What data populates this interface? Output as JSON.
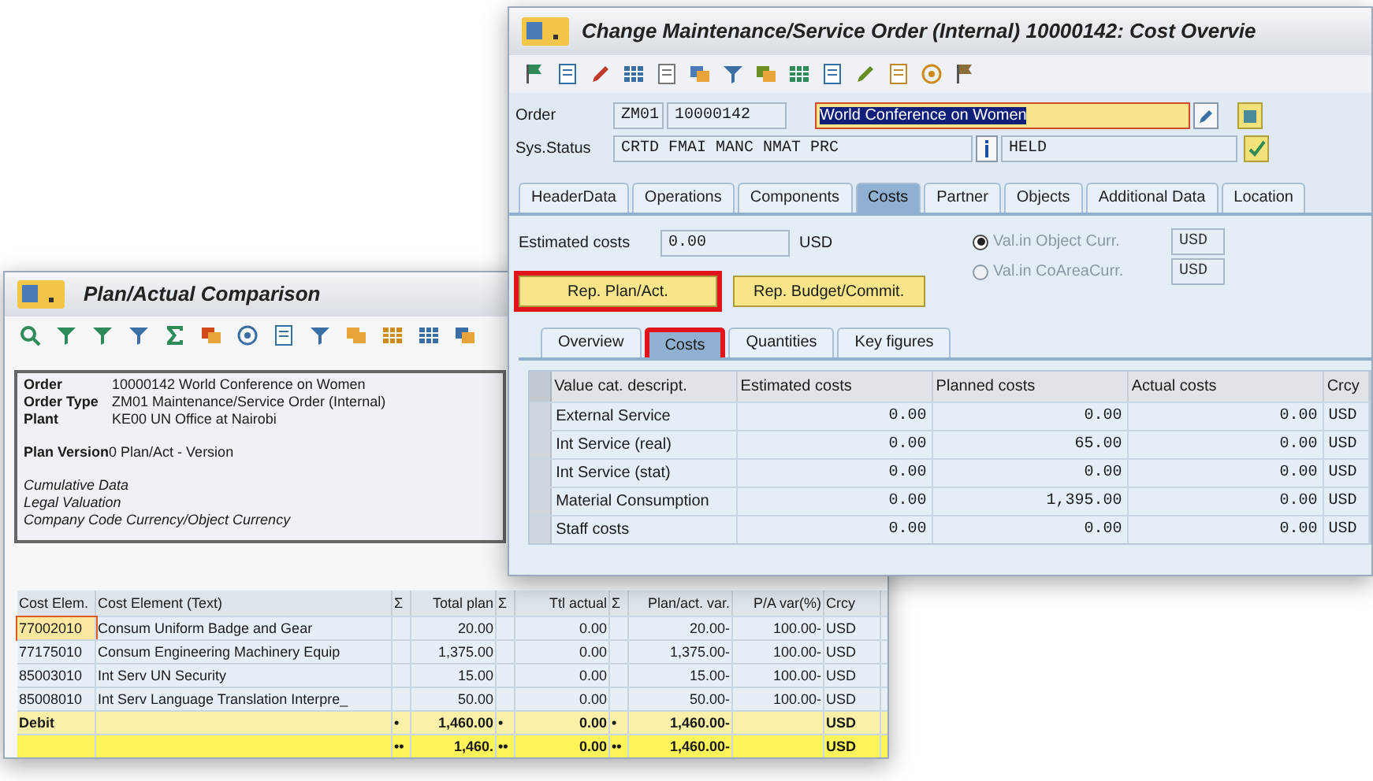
{
  "order_window": {
    "title": "Change Maintenance/Service Order (Internal) 10000142: Cost Overvie",
    "order": {
      "label": "Order",
      "type": "ZM01",
      "number": "10000142",
      "description": "World Conference on Women"
    },
    "status": {
      "label": "Sys.Status",
      "system_status": "CRTD FMAI MANC NMAT PRC",
      "user_status": "HELD"
    },
    "tabs": [
      {
        "label": "HeaderData",
        "selected": false
      },
      {
        "label": "Operations",
        "selected": false
      },
      {
        "label": "Components",
        "selected": false
      },
      {
        "label": "Costs",
        "selected": true
      },
      {
        "label": "Partner",
        "selected": false
      },
      {
        "label": "Objects",
        "selected": false
      },
      {
        "label": "Additional Data",
        "selected": false
      },
      {
        "label": "Location",
        "selected": false
      }
    ],
    "estimated_costs": {
      "label": "Estimated costs",
      "value": "0.00",
      "currency": "USD"
    },
    "currency_options": [
      {
        "label": "Val.in Object Curr.",
        "selected": true,
        "currency": "USD"
      },
      {
        "label": "Val.in CoAreaCurr.",
        "selected": false,
        "currency": "USD"
      }
    ],
    "buttons": [
      {
        "label": "Rep. Plan/Act.",
        "highlighted": true
      },
      {
        "label": "Rep. Budget/Commit.",
        "highlighted": false
      }
    ],
    "subtabs": [
      {
        "label": "Overview",
        "selected": false,
        "highlighted": false
      },
      {
        "label": "Costs",
        "selected": true,
        "highlighted": true
      },
      {
        "label": "Quantities",
        "selected": false,
        "highlighted": false
      },
      {
        "label": "Key figures",
        "selected": false,
        "highlighted": false
      }
    ],
    "table": {
      "columns": [
        "Value cat. descript.",
        "Estimated costs",
        "Planned costs",
        "Actual costs",
        "Crcy"
      ],
      "rows": [
        [
          "External Service",
          "0.00",
          "0.00",
          "0.00",
          "USD"
        ],
        [
          "Int Service (real)",
          "0.00",
          "65.00",
          "0.00",
          "USD"
        ],
        [
          "Int Service (stat)",
          "0.00",
          "0.00",
          "0.00",
          "USD"
        ],
        [
          "Material Consumption",
          "0.00",
          "1,395.00",
          "0.00",
          "USD"
        ],
        [
          "Staff costs",
          "0.00",
          "0.00",
          "0.00",
          "USD"
        ]
      ]
    }
  },
  "comparison_window": {
    "title": "Plan/Actual Comparison",
    "header": [
      {
        "label": "Order",
        "value": "10000142 World Conference on Women"
      },
      {
        "label": "Order Type",
        "value": "ZM01 Maintenance/Service Order (Internal)"
      },
      {
        "label": "Plant",
        "value": "KE00 UN Office at Nairobi"
      }
    ],
    "plan_version": {
      "label": "Plan Version",
      "value": "0 Plan/Act - Version"
    },
    "notes": [
      "Cumulative Data",
      "Legal Valuation",
      "Company Code Currency/Object Currency"
    ],
    "table": {
      "columns": [
        "Cost Elem.",
        "Cost Element (Text)",
        "Σ",
        "Total plan",
        "Σ",
        "Ttl actual",
        "Σ",
        "Plan/act. var.",
        "P/A var(%)",
        "Crcy"
      ],
      "rows": [
        {
          "kind": "item",
          "focused": true,
          "cost_elem": "77002010",
          "text": "Consum Uniform Badge and Gear",
          "total_plan": "20.00",
          "ttl_actual": "0.00",
          "plan_act_var": "20.00-",
          "pa_var": "100.00-",
          "crcy": "USD"
        },
        {
          "kind": "item",
          "focused": false,
          "cost_elem": "77175010",
          "text": "Consum Engineering Machinery Equip",
          "total_plan": "1,375.00",
          "ttl_actual": "0.00",
          "plan_act_var": "1,375.00-",
          "pa_var": "100.00-",
          "crcy": "USD"
        },
        {
          "kind": "item",
          "focused": false,
          "cost_elem": "85003010",
          "text": "Int Serv UN Security",
          "total_plan": "15.00",
          "ttl_actual": "0.00",
          "plan_act_var": "15.00-",
          "pa_var": "100.00-",
          "crcy": "USD"
        },
        {
          "kind": "item",
          "focused": false,
          "cost_elem": "85008010",
          "text": "Int Serv Language Translation Interpre_",
          "total_plan": "50.00",
          "ttl_actual": "0.00",
          "plan_act_var": "50.00-",
          "pa_var": "100.00-",
          "crcy": "USD"
        },
        {
          "kind": "subtotal",
          "focused": false,
          "cost_elem": "Debit",
          "plan_mark": "•",
          "total_plan": "1,460.00",
          "actual_mark": "•",
          "ttl_actual": "0.00",
          "var_mark": "•",
          "plan_act_var": "1,460.00-",
          "crcy": "USD"
        },
        {
          "kind": "total",
          "focused": false,
          "plan_mark": "••",
          "total_plan": "1,460.",
          "actual_mark": "••",
          "ttl_actual": "0.00",
          "var_mark": "••",
          "plan_act_var": "1,460.00-",
          "crcy": "USD"
        }
      ]
    }
  }
}
